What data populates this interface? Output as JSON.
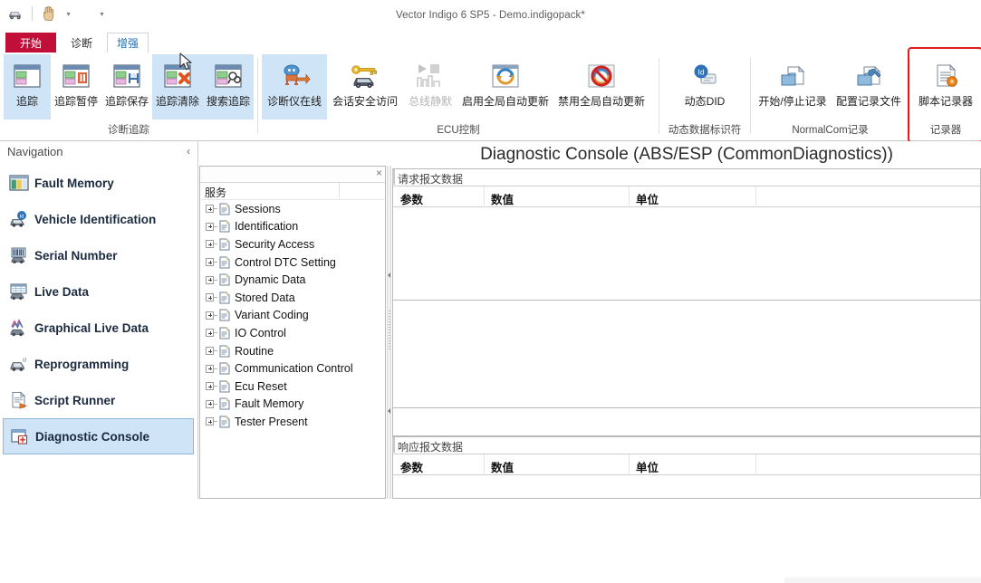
{
  "window": {
    "title": "Vector Indigo 6 SP5 - Demo.indigopack*"
  },
  "quick_access": {
    "buttons": [
      {
        "name": "vehicle-icon",
        "tooltip": "Vehicle"
      },
      {
        "name": "hand-icon",
        "tooltip": "Hand"
      }
    ],
    "caret": "▾",
    "dropdown_caret": "▾"
  },
  "ribbon": {
    "tabs": [
      {
        "id": "start",
        "label": "开始",
        "state": "highlight"
      },
      {
        "id": "diagnosis",
        "label": "诊断",
        "state": "normal"
      },
      {
        "id": "enhanced",
        "label": "增强",
        "state": "active"
      }
    ],
    "groups": [
      {
        "id": "diag-trace",
        "label": "诊断追踪",
        "buttons": [
          {
            "id": "trace",
            "label": "追踪",
            "icon": "trace-icon",
            "selected": true,
            "disabled": false
          },
          {
            "id": "trace-pause",
            "label": "追踪暂停",
            "icon": "trace-pause-icon",
            "selected": false,
            "disabled": false
          },
          {
            "id": "trace-save",
            "label": "追踪保存",
            "icon": "trace-save-icon",
            "selected": false,
            "disabled": false
          },
          {
            "id": "trace-clear",
            "label": "追踪清除",
            "icon": "trace-clear-icon",
            "selected": true,
            "disabled": false
          },
          {
            "id": "trace-search",
            "label": "搜索追踪",
            "icon": "trace-search-icon",
            "selected": true,
            "disabled": false
          }
        ]
      },
      {
        "id": "ecu-control",
        "label": "ECU控制",
        "buttons": [
          {
            "id": "tester-online",
            "label": "诊断仪在线",
            "icon": "tester-online-icon",
            "selected": true,
            "disabled": false
          },
          {
            "id": "security-access",
            "label": "会话安全访问",
            "icon": "security-key-icon",
            "selected": false,
            "disabled": false
          },
          {
            "id": "bus-silence",
            "label": "总线静默",
            "icon": "bus-silence-icon",
            "selected": false,
            "disabled": true
          },
          {
            "id": "enable-autoupdate",
            "label": "启用全局自动更新",
            "icon": "enable-autoupdate-icon",
            "selected": false,
            "disabled": false
          },
          {
            "id": "disable-autoupdate",
            "label": "禁用全局自动更新",
            "icon": "disable-autoupdate-icon",
            "selected": false,
            "disabled": false
          }
        ]
      },
      {
        "id": "dynamic-did",
        "label": "动态数据标识符",
        "buttons": [
          {
            "id": "dynamic-did",
            "label": "动态DID",
            "icon": "dynamic-did-icon",
            "selected": false,
            "disabled": false
          }
        ]
      },
      {
        "id": "normalcom-log",
        "label": "NormalCom记录",
        "buttons": [
          {
            "id": "start-stop-log",
            "label": "开始/停止记录",
            "icon": "start-stop-log-icon",
            "selected": false,
            "disabled": false
          },
          {
            "id": "config-log-file",
            "label": "配置记录文件",
            "icon": "config-log-file-icon",
            "selected": false,
            "disabled": false
          }
        ]
      },
      {
        "id": "recorder",
        "label": "记录器",
        "highlighted": true,
        "buttons": [
          {
            "id": "script-recorder",
            "label": "脚本记录器",
            "icon": "script-recorder-icon",
            "selected": false,
            "disabled": false
          }
        ]
      }
    ]
  },
  "navigation": {
    "title": "Navigation",
    "collapse_glyph": "‹",
    "items": [
      {
        "id": "fault-memory",
        "label": "Fault Memory",
        "icon": "fault-memory-icon",
        "selected": false
      },
      {
        "id": "vehicle-identification",
        "label": "Vehicle Identification",
        "icon": "vehicle-id-icon",
        "selected": false
      },
      {
        "id": "serial-number",
        "label": "Serial Number",
        "icon": "serial-number-icon",
        "selected": false
      },
      {
        "id": "live-data",
        "label": "Live Data",
        "icon": "live-data-icon",
        "selected": false
      },
      {
        "id": "graphical-live-data",
        "label": "Graphical Live Data",
        "icon": "graphical-live-data-icon",
        "selected": false
      },
      {
        "id": "reprogramming",
        "label": "Reprogramming",
        "icon": "reprogramming-icon",
        "selected": false
      },
      {
        "id": "script-runner",
        "label": "Script Runner",
        "icon": "script-runner-icon",
        "selected": false
      },
      {
        "id": "diagnostic-console",
        "label": "Diagnostic Console",
        "icon": "diagnostic-console-icon",
        "selected": true
      }
    ]
  },
  "service_tree": {
    "close_glyph": "×",
    "column_header": "服务",
    "nodes": [
      {
        "label": "Sessions"
      },
      {
        "label": "Identification"
      },
      {
        "label": "Security Access"
      },
      {
        "label": "Control DTC Setting"
      },
      {
        "label": "Dynamic Data"
      },
      {
        "label": "Stored Data"
      },
      {
        "label": "Variant Coding"
      },
      {
        "label": "IO Control"
      },
      {
        "label": "Routine"
      },
      {
        "label": "Communication Control"
      },
      {
        "label": "Ecu Reset"
      },
      {
        "label": "Fault Memory"
      },
      {
        "label": "Tester Present"
      }
    ]
  },
  "console": {
    "title": "Diagnostic Console (ABS/ESP (CommonDiagnostics))",
    "request_grid": {
      "title": "请求报文数据",
      "columns": [
        "参数",
        "数值",
        "单位"
      ],
      "rows": []
    },
    "response_grid": {
      "title": "响应报文数据",
      "columns": [
        "参数",
        "数值",
        "单位"
      ],
      "rows": []
    }
  },
  "colors": {
    "tab_active_red": "#c10f3a",
    "selection_blue": "#cfe4f7",
    "annotation_red": "#e01c1c"
  }
}
